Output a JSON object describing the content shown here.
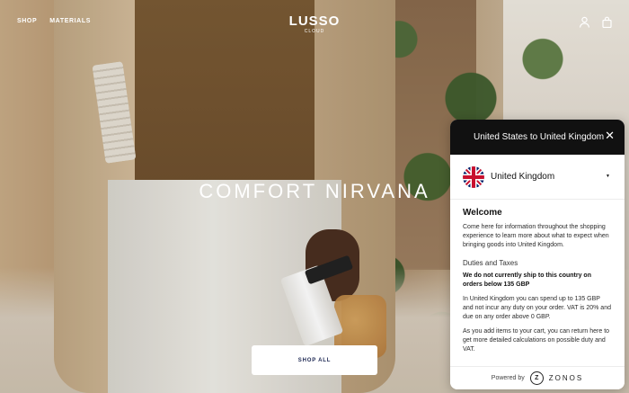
{
  "header": {
    "nav": [
      "SHOP",
      "MATERIALS"
    ],
    "logo": {
      "main": "LUSSO",
      "sub": "CLOUD"
    },
    "icons": [
      "account-icon",
      "cart-icon"
    ]
  },
  "hero": {
    "title": "COMFORT NIRVANA",
    "cta": "SHOP ALL"
  },
  "zonos_panel": {
    "header": "United States to United Kingdom",
    "close": "✕",
    "country": {
      "name": "United Kingdom",
      "flag": "uk-flag-icon",
      "caret": "▼"
    },
    "welcome_title": "Welcome",
    "intro": "Come here for information throughout the shopping experience to learn more about what to expect when bringing goods into United Kingdom.",
    "duties_title": "Duties and Taxes",
    "notice": "We do not currently ship to this country on orders below 135 GBP",
    "duty_info": "In United Kingdom you can spend up to 135 GBP and not incur any duty on your order. VAT is 20% and due on any order above 0 GBP.",
    "cart_info": "As you add items to your cart, you can return here to get more detailed calculations on possible duty and VAT.",
    "powered_by": "Powered by",
    "brand": "ZONOS",
    "brand_mark": "Z"
  },
  "colors": {
    "panel_header_bg": "#111111",
    "cta_text": "#1c2752",
    "hero_text": "#ffffff"
  }
}
